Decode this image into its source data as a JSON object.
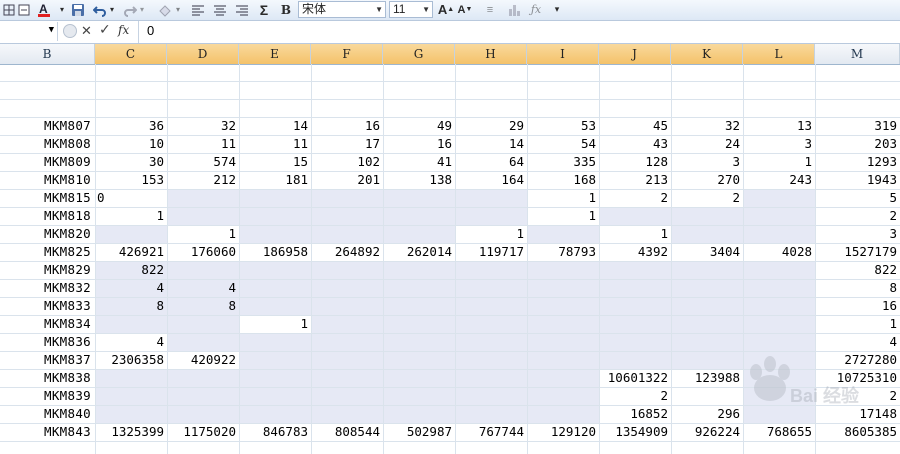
{
  "toolbar": {
    "font_name": "宋体",
    "font_size": "11",
    "bold_label": "B",
    "sum_label": "Σ",
    "fx_label": "fx"
  },
  "formula_bar": {
    "value": "0"
  },
  "columns": [
    "B",
    "C",
    "D",
    "E",
    "F",
    "G",
    "H",
    "I",
    "J",
    "K",
    "L",
    "M"
  ],
  "rows": [
    {
      "label": "MKM807",
      "cells": [
        "36",
        "32",
        "14",
        "16",
        "49",
        "29",
        "53",
        "45",
        "32",
        "13",
        "319"
      ]
    },
    {
      "label": "MKM808",
      "cells": [
        "10",
        "11",
        "11",
        "17",
        "16",
        "14",
        "54",
        "43",
        "24",
        "3",
        "203"
      ]
    },
    {
      "label": "MKM809",
      "cells": [
        "30",
        "574",
        "15",
        "102",
        "41",
        "64",
        "335",
        "128",
        "3",
        "1",
        "1293"
      ]
    },
    {
      "label": "MKM810",
      "cells": [
        "153",
        "212",
        "181",
        "201",
        "138",
        "164",
        "168",
        "213",
        "270",
        "243",
        "1943"
      ]
    },
    {
      "label": "MKM815",
      "cells": [
        "0",
        "",
        "",
        "",
        "",
        "",
        "1",
        "2",
        "2",
        "",
        "5"
      ]
    },
    {
      "label": "MKM818",
      "cells": [
        "1",
        "",
        "",
        "",
        "",
        "",
        "1",
        "",
        "",
        "",
        "2"
      ]
    },
    {
      "label": "MKM820",
      "cells": [
        "",
        "1",
        "",
        "",
        "",
        "1",
        "",
        "1",
        "",
        "",
        "3"
      ]
    },
    {
      "label": "MKM825",
      "cells": [
        "426921",
        "176060",
        "186958",
        "264892",
        "262014",
        "119717",
        "78793",
        "4392",
        "3404",
        "4028",
        "1527179"
      ]
    },
    {
      "label": "MKM829",
      "cells": [
        "822",
        "",
        "",
        "",
        "",
        "",
        "",
        "",
        "",
        "",
        "822"
      ]
    },
    {
      "label": "MKM832",
      "cells": [
        "4",
        "4",
        "",
        "",
        "",
        "",
        "",
        "",
        "",
        "",
        "8"
      ]
    },
    {
      "label": "MKM833",
      "cells": [
        "8",
        "8",
        "",
        "",
        "",
        "",
        "",
        "",
        "",
        "",
        "16"
      ]
    },
    {
      "label": "MKM834",
      "cells": [
        "",
        "",
        "1",
        "",
        "",
        "",
        "",
        "",
        "",
        "",
        "1"
      ]
    },
    {
      "label": "MKM836",
      "cells": [
        "4",
        "",
        "",
        "",
        "",
        "",
        "",
        "",
        "",
        "",
        "4"
      ]
    },
    {
      "label": "MKM837",
      "cells": [
        "2306358",
        "420922",
        "",
        "",
        "",
        "",
        "",
        "",
        "",
        "",
        "2727280"
      ]
    },
    {
      "label": "MKM838",
      "cells": [
        "",
        "",
        "",
        "",
        "",
        "",
        "",
        "10601322",
        "123988",
        "",
        "10725310"
      ]
    },
    {
      "label": "MKM839",
      "cells": [
        "",
        "",
        "",
        "",
        "",
        "",
        "",
        "2",
        "",
        "",
        "2"
      ]
    },
    {
      "label": "MKM840",
      "cells": [
        "",
        "",
        "",
        "",
        "",
        "",
        "",
        "16852",
        "296",
        "",
        "17148"
      ]
    },
    {
      "label": "MKM843",
      "cells": [
        "1325399",
        "1175020",
        "846783",
        "808544",
        "502987",
        "767744",
        "129120",
        "1354909",
        "926224",
        "768655",
        "8605385"
      ]
    }
  ],
  "watermark_text": "Bai 经验",
  "colors": {
    "selected_header": "#f4c26a",
    "shaded_cell": "#e6e9f5",
    "gridline": "#dae3ec"
  }
}
